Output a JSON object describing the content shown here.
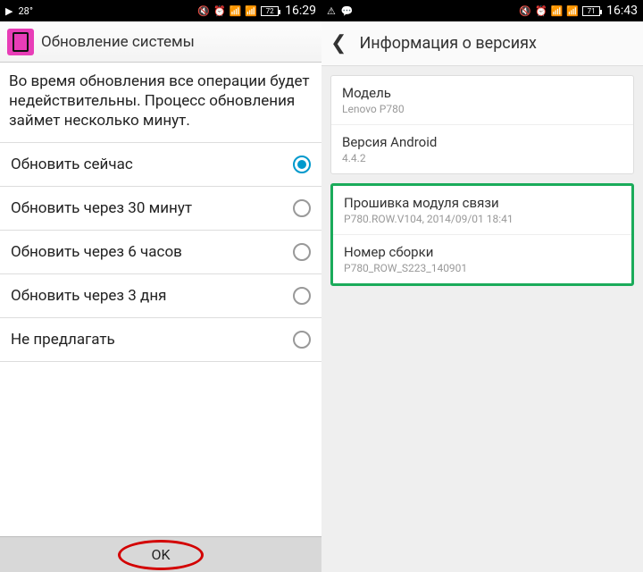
{
  "left": {
    "status": {
      "temp": "28°",
      "battery": "72",
      "time": "16:29"
    },
    "header": {
      "title": "Обновление системы"
    },
    "description": "Во время обновления все операции будет недействительны. Процесс обновления займет несколько минут.",
    "options": [
      {
        "label": "Обновить сейчас",
        "selected": true
      },
      {
        "label": "Обновить через 30 минут",
        "selected": false
      },
      {
        "label": "Обновить через 6 часов",
        "selected": false
      },
      {
        "label": "Обновить через 3 дня",
        "selected": false
      },
      {
        "label": "Не предлагать",
        "selected": false
      }
    ],
    "ok_label": "OK"
  },
  "right": {
    "status": {
      "battery": "71",
      "time": "16:43"
    },
    "header": {
      "title": "Информация о версиях"
    },
    "rows": [
      {
        "label": "Модель",
        "value": "Lenovo P780"
      },
      {
        "label": "Версия Android",
        "value": "4.4.2"
      },
      {
        "label": "Прошивка модуля связи",
        "value": "P780.ROW.V104, 2014/09/01 18:41"
      },
      {
        "label": "Номер сборки",
        "value": "P780_ROW_S223_140901"
      }
    ]
  }
}
